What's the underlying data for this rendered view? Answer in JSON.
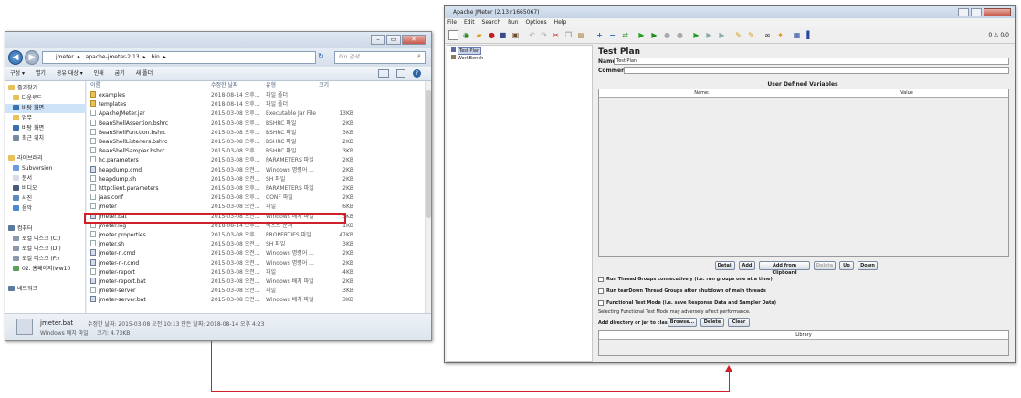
{
  "explorer": {
    "window_buttons": [
      "–",
      "▭",
      "✕"
    ],
    "address": [
      "jmeter",
      "apache-jmeter-2.13",
      "bin"
    ],
    "search_placeholder": "bin 검색",
    "toolbar": [
      "구성 ▾",
      "열기",
      "공유 대상 ▾",
      "인쇄",
      "굽기",
      "새 폴더"
    ],
    "nav": [
      {
        "label": "즐겨찾기",
        "color": "#e8c15a"
      },
      {
        "label": "다운로드",
        "color": "#e8c15a"
      },
      {
        "label": "바탕 화면",
        "color": "#3a6fb0",
        "selected": true
      },
      {
        "label": "업무",
        "color": "#e8c15a"
      },
      {
        "label": "바탕 화면",
        "color": "#3a6fb0"
      },
      {
        "label": "최근 위치",
        "color": "#7a8aa0"
      },
      {
        "label": "",
        "color": ""
      },
      {
        "label": "라이브러리",
        "color": "#e8c15a"
      },
      {
        "label": "Subversion",
        "color": "#6b9be0"
      },
      {
        "label": "문서",
        "color": "#d7dde8"
      },
      {
        "label": "비디오",
        "color": "#4a5a7a"
      },
      {
        "label": "사진",
        "color": "#5a8ac0"
      },
      {
        "label": "음악",
        "color": "#4a8ad0"
      },
      {
        "label": "",
        "color": ""
      },
      {
        "label": "컴퓨터",
        "color": "#5a7aa0"
      },
      {
        "label": "로컬 디스크 (C:)",
        "color": "#8a9aaa"
      },
      {
        "label": "로컬 디스크 (D:)",
        "color": "#8a9aaa"
      },
      {
        "label": "로컬 디스크 (F:)",
        "color": "#8a9aaa"
      },
      {
        "label": "02. 홈페이지(ww10",
        "color": "#5aa05a"
      },
      {
        "label": "",
        "color": ""
      },
      {
        "label": "네트워크",
        "color": "#5a7aa0"
      }
    ],
    "columns": [
      "이름",
      "수정한 날짜",
      "유형",
      "크기"
    ],
    "files": [
      {
        "name": "examples",
        "date": "2018-08-14 오후...",
        "type": "파일 폴더",
        "size": "",
        "kind": "folder"
      },
      {
        "name": "templates",
        "date": "2018-08-14 오후...",
        "type": "파일 폴더",
        "size": "",
        "kind": "folder"
      },
      {
        "name": "ApacheJMeter.jar",
        "date": "2015-03-08 오후...",
        "type": "Executable Jar File",
        "size": "13KB",
        "kind": "file"
      },
      {
        "name": "BeanShellAssertion.bshrc",
        "date": "2015-03-08 오후...",
        "type": "BSHRC 파일",
        "size": "2KB",
        "kind": "file"
      },
      {
        "name": "BeanShellFunction.bshrc",
        "date": "2015-03-08 오후...",
        "type": "BSHRC 파일",
        "size": "3KB",
        "kind": "file"
      },
      {
        "name": "BeanShellListeners.bshrc",
        "date": "2015-03-08 오후...",
        "type": "BSHRC 파일",
        "size": "2KB",
        "kind": "file"
      },
      {
        "name": "BeanShellSampler.bshrc",
        "date": "2015-03-08 오후...",
        "type": "BSHRC 파일",
        "size": "3KB",
        "kind": "file"
      },
      {
        "name": "hc.parameters",
        "date": "2015-03-08 오후...",
        "type": "PARAMETERS 파일",
        "size": "2KB",
        "kind": "file"
      },
      {
        "name": "heapdump.cmd",
        "date": "2015-03-08 오전...",
        "type": "Windows 명령어 ...",
        "size": "2KB",
        "kind": "cmd"
      },
      {
        "name": "heapdump.sh",
        "date": "2015-03-08 오전...",
        "type": "SH 파일",
        "size": "2KB",
        "kind": "file"
      },
      {
        "name": "httpclient.parameters",
        "date": "2015-03-08 오후...",
        "type": "PARAMETERS 파일",
        "size": "2KB",
        "kind": "file"
      },
      {
        "name": "jaas.conf",
        "date": "2015-03-08 오후...",
        "type": "CONF 파일",
        "size": "2KB",
        "kind": "file"
      },
      {
        "name": "jmeter",
        "date": "2015-03-08 오전...",
        "type": "파일",
        "size": "6KB",
        "kind": "file"
      },
      {
        "name": "jmeter.bat",
        "date": "2015-03-08 오전...",
        "type": "Windows 배치 파일",
        "size": "5KB",
        "kind": "cmd",
        "highlight": true
      },
      {
        "name": "jmeter.log",
        "date": "2018-08-14 오후...",
        "type": "텍스트 문서",
        "size": "1KB",
        "kind": "file"
      },
      {
        "name": "jmeter.properties",
        "date": "2015-03-08 오후...",
        "type": "PROPERTIES 파일",
        "size": "47KB",
        "kind": "file"
      },
      {
        "name": "jmeter.sh",
        "date": "2015-03-08 오전...",
        "type": "SH 파일",
        "size": "3KB",
        "kind": "file"
      },
      {
        "name": "jmeter-n.cmd",
        "date": "2015-03-08 오전...",
        "type": "Windows 명령어 ...",
        "size": "2KB",
        "kind": "cmd"
      },
      {
        "name": "jmeter-n-r.cmd",
        "date": "2015-03-08 오전...",
        "type": "Windows 명령어 ...",
        "size": "2KB",
        "kind": "cmd"
      },
      {
        "name": "jmeter-report",
        "date": "2015-03-08 오전...",
        "type": "파일",
        "size": "4KB",
        "kind": "file"
      },
      {
        "name": "jmeter-report.bat",
        "date": "2015-03-08 오전...",
        "type": "Windows 배치 파일",
        "size": "2KB",
        "kind": "cmd"
      },
      {
        "name": "jmeter-server",
        "date": "2015-03-08 오전...",
        "type": "파일",
        "size": "3KB",
        "kind": "file"
      },
      {
        "name": "jmeter-server.bat",
        "date": "2015-03-08 오전...",
        "type": "Windows 배치 파일",
        "size": "3KB",
        "kind": "cmd"
      }
    ],
    "status": {
      "name": "jmeter.bat",
      "modified": "수정한 날짜: 2015-03-08 오전 10:13  만든 날짜: 2018-08-14 오후 4:23",
      "type": "Windows 배치 파일",
      "size": "크기: 4.73KB"
    }
  },
  "jmeter": {
    "title": "Apache JMeter (2.13 r1665067)",
    "menu": [
      "File",
      "Edit",
      "Search",
      "Run",
      "Options",
      "Help"
    ],
    "status_right": "0 ⚠   0/0",
    "tree": [
      "Test Plan",
      "WorkBench"
    ],
    "panel": {
      "heading": "Test Plan",
      "name_label": "Name:",
      "name_value": "Test Plan",
      "comments_label": "Comments:",
      "udv_title": "User Defined Variables",
      "udv_columns": [
        "Name:",
        "Value"
      ],
      "buttons": [
        "Detail",
        "Add",
        "Add from Clipboard",
        "Delete",
        "Up",
        "Down"
      ],
      "checkboxes": [
        "Run Thread Groups consecutively (i.e. run groups one at a time)",
        "Run tearDown Thread Groups after shutdown of main threads",
        "Functional Test Mode (i.e. save Response Data and Sampler Data)"
      ],
      "note": "Selecting Functional Test Mode may adversely affect performance.",
      "classpath_label": "Add directory or jar to classpath",
      "classpath_buttons": [
        "Browse...",
        "Delete",
        "Clear"
      ],
      "library_header": "Library"
    }
  }
}
